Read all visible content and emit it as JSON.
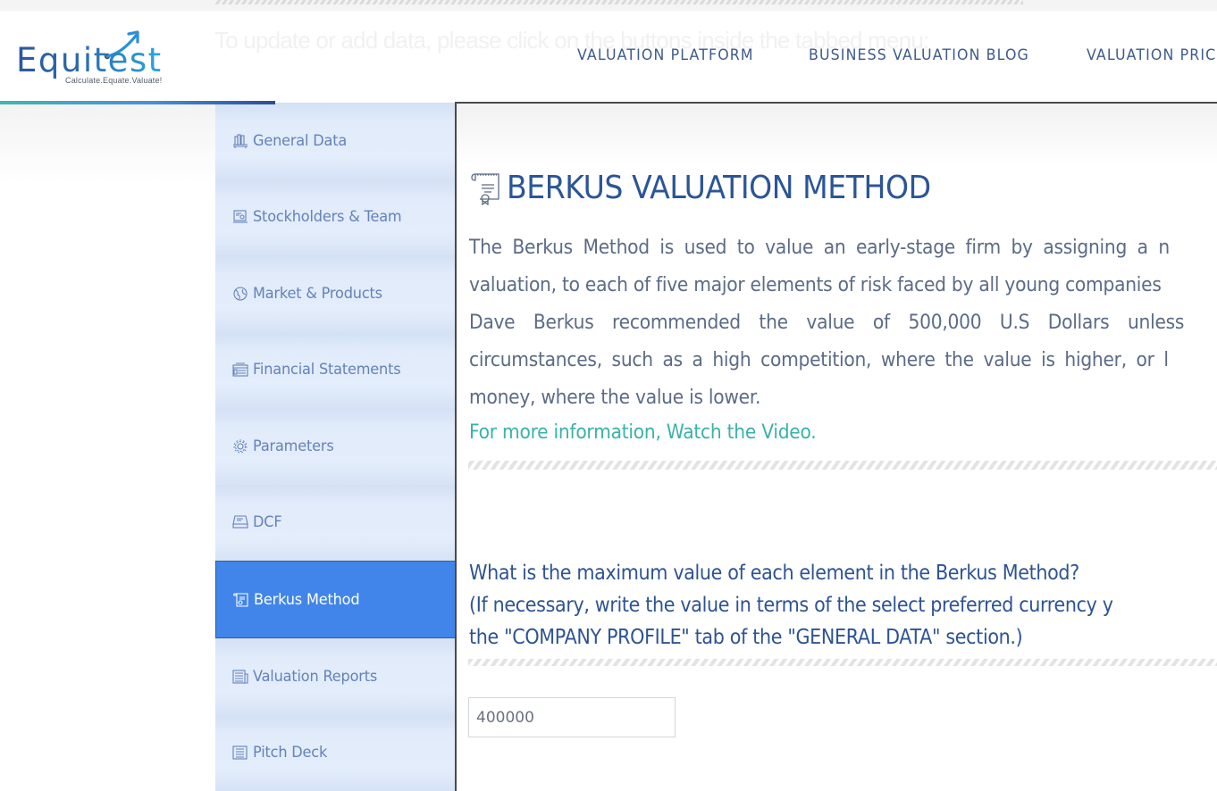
{
  "header": {
    "logo": {
      "wordmark": "Equitest",
      "tagline": "Calculate.Equate.Valuate!"
    },
    "background_hint": "To update or add data, please click on the buttons inside the tabbed menu:",
    "nav": [
      {
        "label": "VALUATION PLATFORM"
      },
      {
        "label": "BUSINESS VALUATION BLOG"
      },
      {
        "label": "VALUATION PRIC"
      }
    ]
  },
  "sidebar": {
    "items": [
      {
        "label": "General Data",
        "icon": "books-icon",
        "active": false
      },
      {
        "label": "Stockholders & Team",
        "icon": "team-board-icon",
        "active": false
      },
      {
        "label": "Market & Products",
        "icon": "globe-icon",
        "active": false
      },
      {
        "label": "Financial Statements",
        "icon": "statements-icon",
        "active": false
      },
      {
        "label": "Parameters",
        "icon": "gear-icon",
        "active": false
      },
      {
        "label": "DCF",
        "icon": "inbox-tray-icon",
        "active": false
      },
      {
        "label": "Berkus Method",
        "icon": "certificate-scroll-icon",
        "active": true
      },
      {
        "label": "Valuation Reports",
        "icon": "report-icon",
        "active": false
      },
      {
        "label": "Pitch Deck",
        "icon": "document-list-icon",
        "active": false
      }
    ]
  },
  "main": {
    "title": "BERKUS VALUATION METHOD",
    "description_lines": [
      "The Berkus Method is used to value an early-stage firm by assigning a n",
      "valuation, to each of five major elements of risk faced by all young companies",
      "Dave Berkus recommended the value of 500,000 U.S Dollars unless",
      "circumstances, such as a high competition, where the value is higher, or l",
      "money, where the value is lower."
    ],
    "more_info_link": "For more information, Watch the Video.",
    "question_lines": [
      "What is the maximum value of each element in the Berkus Method?",
      "(If necessary, write the value in terms of the select preferred currency y",
      "the \"COMPANY PROFILE\" tab of the \"GENERAL DATA\" section.)"
    ],
    "max_value_input": {
      "value": "400000"
    }
  },
  "colors": {
    "primary_blue": "#2b5597",
    "active_tab": "#4185ea",
    "sidebar_bg": "#dbe6f8",
    "sidebar_text": "#6482b8",
    "link_teal": "#3ab2a9",
    "body_text": "#5c6b85"
  }
}
